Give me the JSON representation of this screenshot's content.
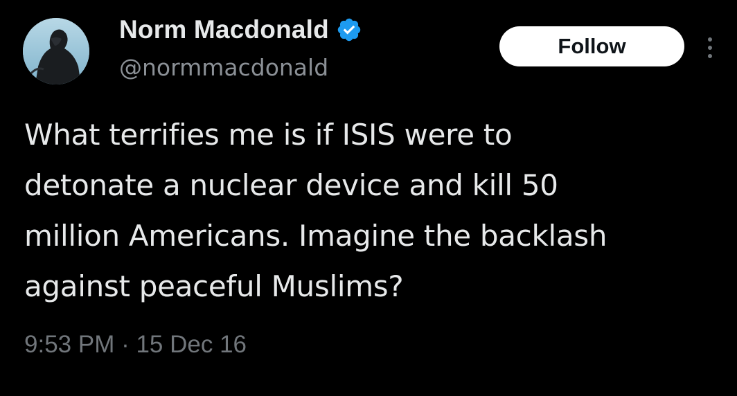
{
  "tweet": {
    "author": {
      "display_name": "Norm Macdonald",
      "handle": "@normmacdonald",
      "verified": true,
      "verified_icon": "verified-badge-icon",
      "verified_color": "#1d9bf0"
    },
    "follow_label": "Follow",
    "more_icon": "vertical-ellipsis-icon",
    "text": "What terrifies me is if ISIS were to\ndetonate a nuclear device and kill 50\nmillion Americans. Imagine the backlash\nagainst peaceful Muslims?",
    "timestamp": "9:53 PM · 15 Dec 16"
  },
  "colors": {
    "background": "#000000",
    "primary_text": "#e7e9ea",
    "secondary_text": "#71767b",
    "follow_button_bg": "#ffffff",
    "follow_button_text": "#0f1419"
  }
}
